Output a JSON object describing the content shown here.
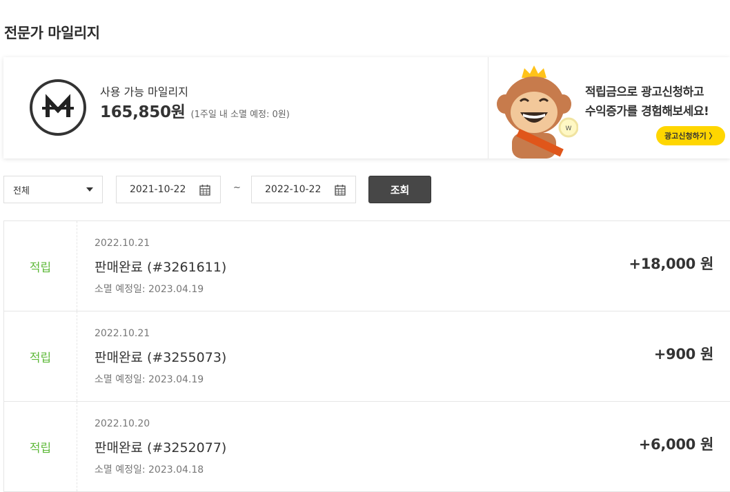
{
  "page": {
    "title": "전문가 마일리지"
  },
  "summary": {
    "available_label": "사용 가능 마일리지",
    "available_amount": "165,850원",
    "expiring_note": "(1주일 내 소멸 예정: 0원)"
  },
  "banner": {
    "line1": "적립금으로 광고신청하고",
    "line2": "수익증가를 경험해보세요!",
    "button_label": "광고신청하기 〉",
    "accent_color": "#ffd600"
  },
  "filters": {
    "type_select": "전체",
    "date_from": "2021-10-22",
    "date_separator": "~",
    "date_to": "2022-10-22",
    "search_label": "조회"
  },
  "history": [
    {
      "type": "적립",
      "date": "2022.10.21",
      "title": "판매완료 (#3261611)",
      "expire": "소멸 예정일: 2023.04.19",
      "amount": "+18,000 원"
    },
    {
      "type": "적립",
      "date": "2022.10.21",
      "title": "판매완료 (#3255073)",
      "expire": "소멸 예정일: 2023.04.19",
      "amount": "+900 원"
    },
    {
      "type": "적립",
      "date": "2022.10.20",
      "title": "판매완료 (#3252077)",
      "expire": "소멸 예정일: 2023.04.18",
      "amount": "+6,000 원"
    }
  ],
  "colors": {
    "earn_type": "#5fb93a",
    "search_button": "#474747"
  }
}
